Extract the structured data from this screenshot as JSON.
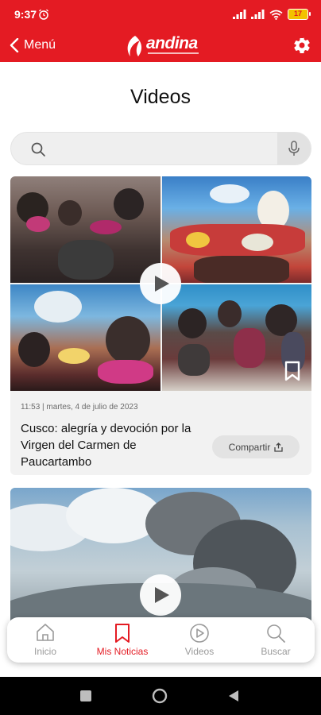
{
  "status_bar": {
    "time": "9:37",
    "battery": "17"
  },
  "header": {
    "back_label": "Menú",
    "logo_text": "andina"
  },
  "page": {
    "title": "Videos"
  },
  "search": {
    "placeholder": ""
  },
  "videos": [
    {
      "meta": "11:53 | martes, 4 de julio de 2023",
      "title": "Cusco: alegría y devoción por la Virgen del Carmen de Paucartambo",
      "share_label": "Compartir"
    },
    {
      "meta": "",
      "title": "",
      "share_label": ""
    }
  ],
  "bottom_nav": [
    {
      "label": "Inicio",
      "icon": "home-icon",
      "active": false
    },
    {
      "label": "Mis Noticias",
      "icon": "bookmark-icon",
      "active": true
    },
    {
      "label": "Videos",
      "icon": "play-circle-icon",
      "active": false
    },
    {
      "label": "Buscar",
      "icon": "search-icon",
      "active": false
    }
  ],
  "colors": {
    "brand": "#e41b23",
    "nav_inactive": "#9a9a9a",
    "card_bg": "#f2f2f2"
  }
}
